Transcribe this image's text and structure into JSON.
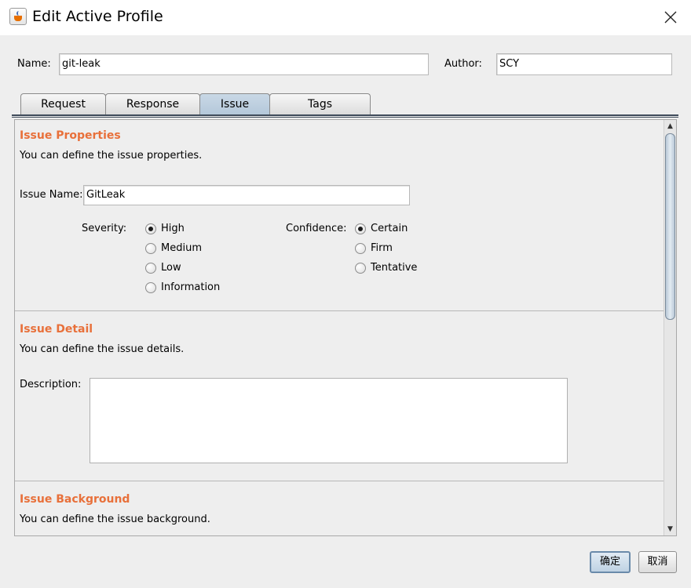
{
  "window": {
    "title": "Edit Active Profile",
    "app_icon": "java-cup-icon",
    "close_icon": "close-icon"
  },
  "profile": {
    "name_label": "Name:",
    "name_value": "git-leak",
    "author_label": "Author:",
    "author_value": "SCY"
  },
  "tabs": [
    {
      "label": "Request",
      "active": false
    },
    {
      "label": "Response",
      "active": false
    },
    {
      "label": "Issue",
      "active": true
    },
    {
      "label": "Tags",
      "active": false
    }
  ],
  "issue_properties": {
    "title": "Issue Properties",
    "description": "You can define the issue properties.",
    "issue_name_label": "Issue Name:",
    "issue_name_value": "GitLeak",
    "severity_label": "Severity:",
    "severity_options": [
      "High",
      "Medium",
      "Low",
      "Information"
    ],
    "severity_selected": "High",
    "confidence_label": "Confidence:",
    "confidence_options": [
      "Certain",
      "Firm",
      "Tentative"
    ],
    "confidence_selected": "Certain"
  },
  "issue_detail": {
    "title": "Issue Detail",
    "description": "You can define the issue details.",
    "description_label": "Description:",
    "description_value": ""
  },
  "issue_background": {
    "title": "Issue Background",
    "description": "You can define the issue background."
  },
  "buttons": {
    "ok_label": "确定",
    "cancel_label": "取消"
  },
  "colors": {
    "section_title": "#e8703a",
    "active_tab": "#b4c8da",
    "background": "#eeeeee"
  }
}
